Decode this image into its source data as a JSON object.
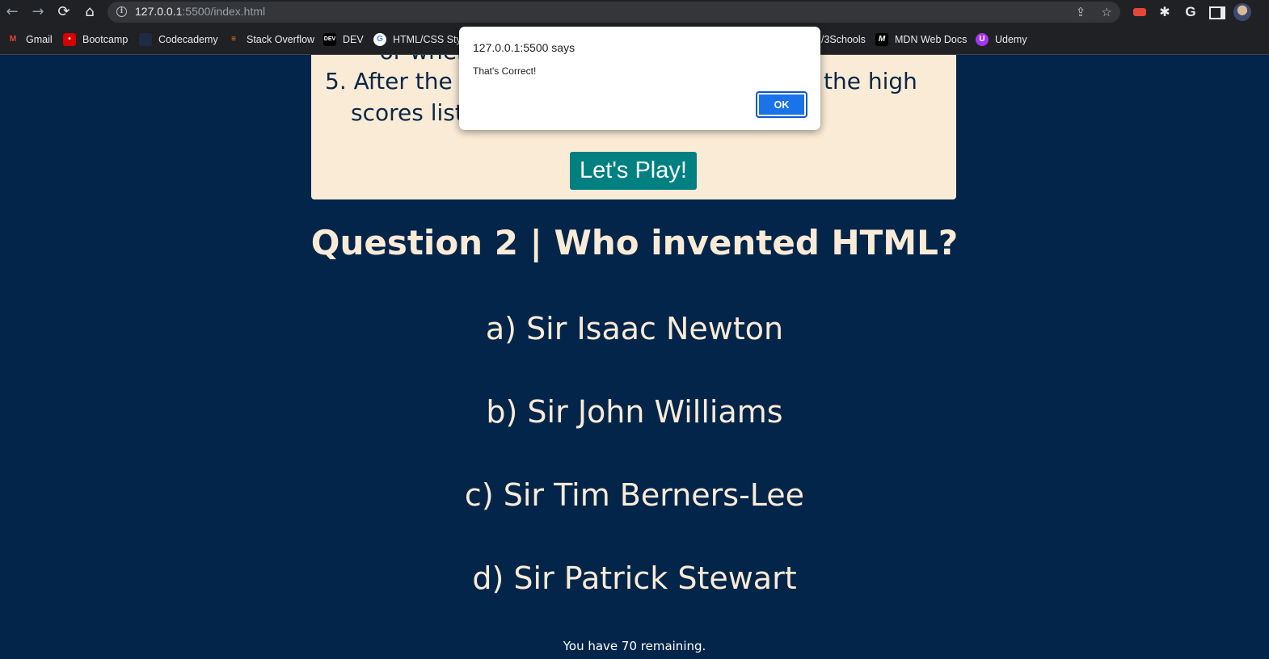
{
  "browser": {
    "url_host": "127.0.0.1",
    "url_rest": ":5500/index.html",
    "bookmarks": [
      {
        "label": "Gmail",
        "icon": "gmail-icon",
        "fav_color": "#ea4335",
        "glyph": "M"
      },
      {
        "label": "Bootcamp",
        "icon": "bootcamp-icon",
        "fav_color": "#d50000",
        "glyph": "•"
      },
      {
        "label": "Codecademy",
        "icon": "codecademy-icon",
        "fav_color": "#1f2a44",
        "glyph": ""
      },
      {
        "label": "Stack Overflow",
        "icon": "stackoverflow-icon",
        "fav_color": "#f48024",
        "glyph": "≡"
      },
      {
        "label": "DEV",
        "icon": "dev-icon",
        "fav_color": "#000000",
        "glyph": "DEV"
      },
      {
        "label": "HTML/CSS Style",
        "icon": "google-icon",
        "fav_color": "#ffffff",
        "glyph": "G"
      },
      {
        "label": "/3Schools",
        "icon": "w3schools-icon",
        "fav_color": "#04aa6d",
        "glyph": ""
      },
      {
        "label": "MDN Web Docs",
        "icon": "mdn-icon",
        "fav_color": "#000000",
        "glyph": "M"
      },
      {
        "label": "Udemy",
        "icon": "udemy-icon",
        "fav_color": "#a435f0",
        "glyph": "U"
      }
    ]
  },
  "rules": {
    "partial_top": "or when y",
    "item5_number": "5.",
    "item5_start": "After the g",
    "item5_end": "the high",
    "item5_line2": "scores list."
  },
  "play_button_label": "Let's Play!",
  "question": {
    "title": "Question 2 | Who invented HTML?",
    "answers": [
      "a) Sir Isaac Newton",
      "b) Sir John Williams",
      "c) Sir Tim Berners-Lee",
      "d) Sir Patrick Stewart"
    ]
  },
  "timer_text": "You have 70 remaining.",
  "alert": {
    "title": "127.0.0.1:5500 says",
    "message": "That's Correct!",
    "ok_label": "OK"
  },
  "colors": {
    "page_bg": "#04254a",
    "card_bg": "#faebd7",
    "accent_teal": "#008080",
    "dialog_button": "#1a73e8"
  }
}
